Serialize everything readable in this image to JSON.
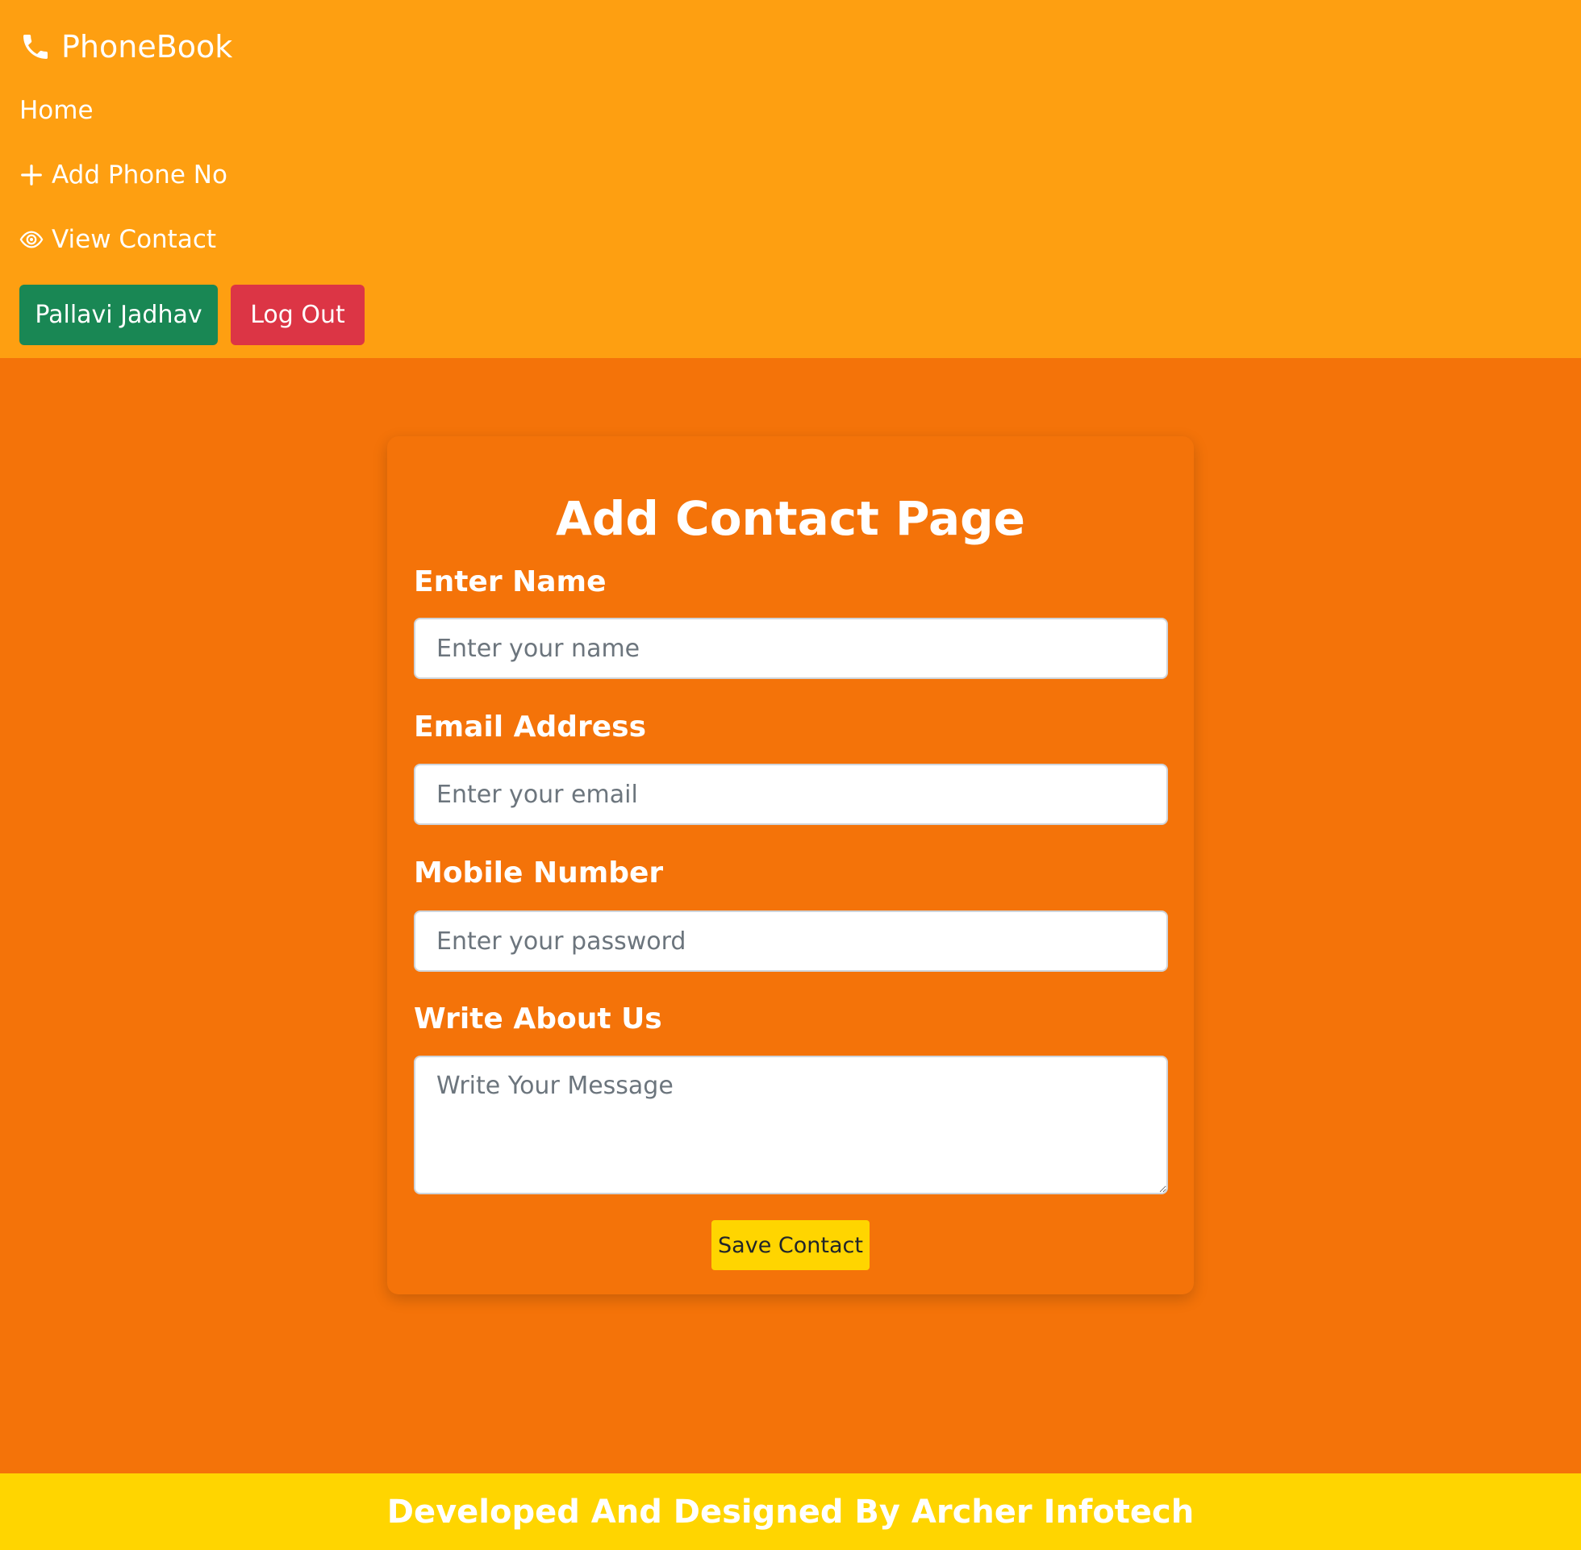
{
  "navbar": {
    "brand": "PhoneBook",
    "brand_icon": "phone-icon",
    "links": {
      "home": "Home",
      "add_phone": "Add Phone No",
      "view_contact": "View Contact"
    },
    "user_button": "Pallavi Jadhav",
    "logout_button": "Log Out"
  },
  "form": {
    "title": "Add Contact Page",
    "name": {
      "label": "Enter Name",
      "placeholder": "Enter your name",
      "value": ""
    },
    "email": {
      "label": "Email Address",
      "placeholder": "Enter your email",
      "value": ""
    },
    "mobile": {
      "label": "Mobile Number",
      "placeholder": "Enter your password",
      "value": ""
    },
    "about": {
      "label": "Write About Us",
      "placeholder": "Write Your Message",
      "value": ""
    },
    "save_button": "Save Contact"
  },
  "footer": {
    "text": "Developed And Designed By Archer Infotech"
  },
  "colors": {
    "navbar_bg": "#fe9f11",
    "page_bg": "#f47309",
    "footer_bg": "#ffd500",
    "user_button_bg": "#198754",
    "logout_button_bg": "#dc3545",
    "save_button_bg": "#ffd500"
  }
}
